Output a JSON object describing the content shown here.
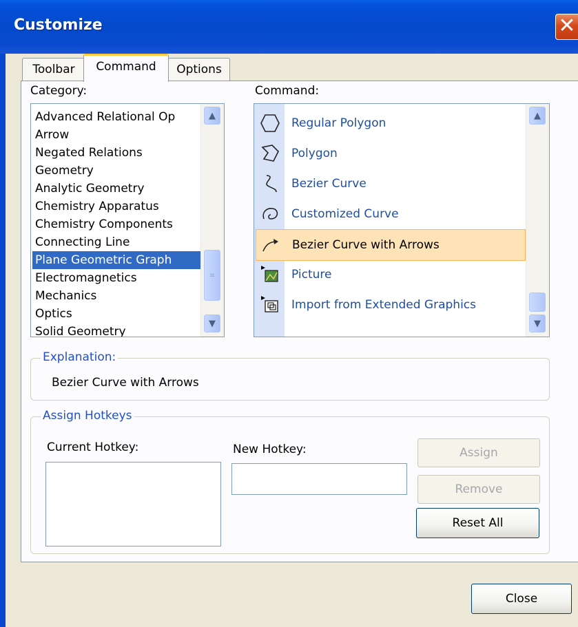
{
  "window": {
    "title": "Customize"
  },
  "tabs": [
    {
      "label": "Toolbar"
    },
    {
      "label": "Command"
    },
    {
      "label": "Options"
    }
  ],
  "category": {
    "label": "Category:",
    "items": [
      "Advanced Relational Op",
      "Arrow",
      "Negated Relations",
      "Geometry",
      "Analytic Geometry",
      "Chemistry Apparatus",
      "Chemistry Components",
      "Connecting Line",
      "Plane Geometric Graph",
      "Electromagnetics",
      "Mechanics",
      "Optics",
      "Solid Geometry"
    ],
    "selected_index": 8
  },
  "command": {
    "label": "Command:",
    "items": [
      {
        "label": "Regular Polygon",
        "icon": "hexagon-icon"
      },
      {
        "label": "Polygon",
        "icon": "polygon-icon"
      },
      {
        "label": "Bezier Curve",
        "icon": "bezier-curve-icon"
      },
      {
        "label": "Customized Curve",
        "icon": "customized-curve-icon"
      },
      {
        "label": "Bezier Curve with Arrows",
        "icon": "curve-arrow-icon"
      },
      {
        "label": "Picture",
        "icon": "picture-icon"
      },
      {
        "label": "Import from Extended Graphics",
        "icon": "import-graphics-icon"
      }
    ],
    "selected_index": 4
  },
  "explanation": {
    "title": "Explanation:",
    "text": "Bezier Curve with Arrows"
  },
  "hotkeys": {
    "title": "Assign Hotkeys",
    "current_label": "Current Hotkey:",
    "new_label": "New Hotkey:",
    "new_value": "",
    "assign_label": "Assign",
    "remove_label": "Remove",
    "reset_label": "Reset All"
  },
  "close_label": "Close",
  "colors": {
    "titlebar": "#0349cb",
    "selection": "#316ac5",
    "command_selection": "#fde3b5",
    "group_title": "#2050c8"
  }
}
